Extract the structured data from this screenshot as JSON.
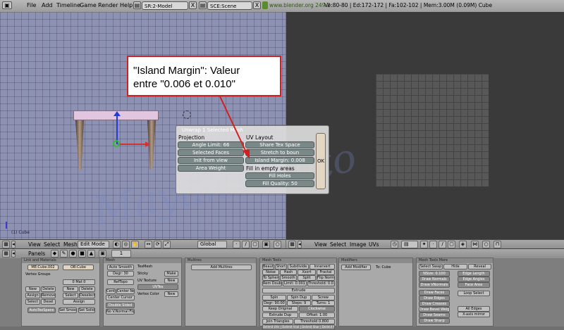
{
  "topbar": {
    "menus": [
      "File",
      "Add",
      "Timeline",
      "Game",
      "Render",
      "Help"
    ],
    "screen_field": "SR:2-Model",
    "scene_field": "SCE:Scene",
    "url": "www.blender.org 249.2",
    "stats": "Ve:80-80 | Ed:172-172 | Fa:102-102 | Mem:3.00M (0.09M) Cube",
    "close": "X"
  },
  "view3d": {
    "object_label": "(1) Cube",
    "header": {
      "view": "View",
      "select": "Select",
      "mesh": "Mesh",
      "mode": "Edit Mode",
      "orientation": "Global"
    }
  },
  "uv_editor": {
    "header": {
      "view": "View",
      "select": "Select",
      "image": "Image",
      "uvs": "UVs"
    }
  },
  "unwrap_popup": {
    "title": "Unwrap 1 Selected Mesh",
    "projection_label": "Projection",
    "angle_limit": "Angle Limit: 66",
    "selected_faces": "Selected Faces",
    "init_from_view": "Init from view",
    "area_weight": "Area Weight",
    "uv_layout_label": "UV Layout",
    "share_tex_space": "Share Tex Space",
    "stretch_to_bounds": "Stretch to boun",
    "island_margin": "Island Margin: 0.008",
    "fill_empty_label": "Fill in empty areas",
    "fill_holes": "Fill Holes",
    "fill_quality": "Fill Quality: 50",
    "ok": "OK"
  },
  "annotation": {
    "text": "\"Island Margin\": Valeur\nentre \"0.006 et 0.010\""
  },
  "watermark": "Maylin - Tuto",
  "buttons": {
    "panels_label": "Panels",
    "frame": "1",
    "link": {
      "title": "Link and Materials",
      "me": "ME:Cube.002",
      "ob": "OB:Cube",
      "vertex_groups": "Vertex Groups",
      "mat": "0 Mat 0",
      "new": "New",
      "delete": "Delete",
      "assign": "Assign",
      "remove": "Remove",
      "select": "Select",
      "deselect": "Deselect",
      "desel": "Desel",
      "autotexspace": "AutoTexSpace",
      "set_smooth": "Set Smooth",
      "set_solid": "Set Solid"
    },
    "mesh": {
      "title": "Mesh",
      "auto_smooth": "Auto Smooth",
      "degr": "Degr: 30",
      "refopo": "RefTopo",
      "sticky": "Sticky",
      "uv_texture": "UV Texture",
      "vertex_color": "Vertex Color",
      "texmesh": "TexMesh",
      "make": "Make",
      "new": "New",
      "uvtex": "UVTex",
      "center": "Center",
      "center_new": "Center New",
      "center_cursor": "Center Cursor",
      "double_sided": "Double Sided",
      "no_vnormal_flip": "No V.Normal Flip"
    },
    "multires": {
      "title": "Multires",
      "add_multires": "Add Multires"
    },
    "mesh_tools": {
      "title": "Mesh Tools",
      "beauty": "Beauty",
      "short": "Short",
      "subdivide": "Subdivide",
      "innervert": "Innervert",
      "noise": "Noise",
      "hash": "Hash",
      "xsort": "Xsort",
      "fractal": "Fractal",
      "to_sphere": "To Sphere",
      "smooth": "Smooth",
      "split": "Split",
      "flip_normals": "Flip Normals",
      "rem_doubles": "Rem Doubles",
      "limit": "Limit: 0.001",
      "threshold": "Threshold: 0.010",
      "extrude": "Extrude",
      "spin": "Spin",
      "spin_dup": "Spin Dup",
      "screw": "Screw",
      "degr": "Degr: 90.00",
      "steps": "Steps: 9",
      "turns": "Turns: 1",
      "keep_original": "Keep Original",
      "clockwise": "Clockwise",
      "extrude_dup": "Extrude Dup",
      "offset": "Offset: 1.00",
      "join_triangles": "Join Triangles",
      "threshold2": "Threshold 0.800",
      "delimit": "Delimit UVs | Delimit Vcol | Delimit Shar | Delimit Mat"
    },
    "modifiers": {
      "title": "Modifiers",
      "add_modifier": "Add Modifier",
      "to": "To: Cube"
    },
    "mesh_tools_more": {
      "title": "Mesh Tools More",
      "select_swap": "Select Swap",
      "hide": "Hide",
      "reveal": "Reveal",
      "nsize": "NSize: 0.100",
      "draw_normals": "Draw Normals",
      "draw_vnormals": "Draw VNormals",
      "edge_length": "Edge Length",
      "edge_angles": "Edge Angles",
      "face_area": "Face Area",
      "draw_faces": "Draw Faces",
      "draw_edges": "Draw Edges",
      "draw_creases": "Draw Creases",
      "draw_bevel": "Draw Bevel Weights",
      "draw_seams": "Draw Seams",
      "draw_sharp": "Draw Sharp",
      "loop_select": "Loop Select",
      "all_edges": "All Edges",
      "x_axis_mirror": "X-axis mirror"
    }
  }
}
